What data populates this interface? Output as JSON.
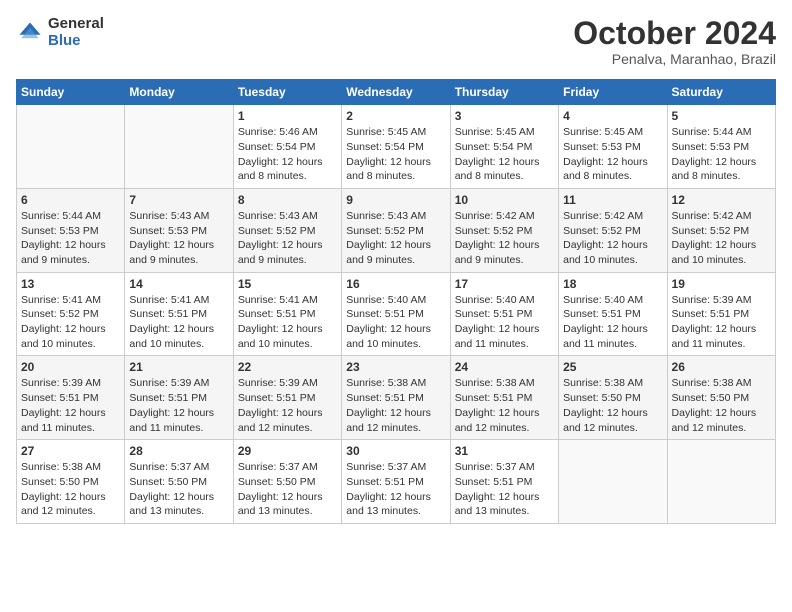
{
  "logo": {
    "general": "General",
    "blue": "Blue"
  },
  "title": "October 2024",
  "location": "Penalva, Maranhao, Brazil",
  "days_of_week": [
    "Sunday",
    "Monday",
    "Tuesday",
    "Wednesday",
    "Thursday",
    "Friday",
    "Saturday"
  ],
  "weeks": [
    [
      {
        "day": "",
        "info": ""
      },
      {
        "day": "",
        "info": ""
      },
      {
        "day": "1",
        "info": "Sunrise: 5:46 AM\nSunset: 5:54 PM\nDaylight: 12 hours and 8 minutes."
      },
      {
        "day": "2",
        "info": "Sunrise: 5:45 AM\nSunset: 5:54 PM\nDaylight: 12 hours and 8 minutes."
      },
      {
        "day": "3",
        "info": "Sunrise: 5:45 AM\nSunset: 5:54 PM\nDaylight: 12 hours and 8 minutes."
      },
      {
        "day": "4",
        "info": "Sunrise: 5:45 AM\nSunset: 5:53 PM\nDaylight: 12 hours and 8 minutes."
      },
      {
        "day": "5",
        "info": "Sunrise: 5:44 AM\nSunset: 5:53 PM\nDaylight: 12 hours and 8 minutes."
      }
    ],
    [
      {
        "day": "6",
        "info": "Sunrise: 5:44 AM\nSunset: 5:53 PM\nDaylight: 12 hours and 9 minutes."
      },
      {
        "day": "7",
        "info": "Sunrise: 5:43 AM\nSunset: 5:53 PM\nDaylight: 12 hours and 9 minutes."
      },
      {
        "day": "8",
        "info": "Sunrise: 5:43 AM\nSunset: 5:52 PM\nDaylight: 12 hours and 9 minutes."
      },
      {
        "day": "9",
        "info": "Sunrise: 5:43 AM\nSunset: 5:52 PM\nDaylight: 12 hours and 9 minutes."
      },
      {
        "day": "10",
        "info": "Sunrise: 5:42 AM\nSunset: 5:52 PM\nDaylight: 12 hours and 9 minutes."
      },
      {
        "day": "11",
        "info": "Sunrise: 5:42 AM\nSunset: 5:52 PM\nDaylight: 12 hours and 10 minutes."
      },
      {
        "day": "12",
        "info": "Sunrise: 5:42 AM\nSunset: 5:52 PM\nDaylight: 12 hours and 10 minutes."
      }
    ],
    [
      {
        "day": "13",
        "info": "Sunrise: 5:41 AM\nSunset: 5:52 PM\nDaylight: 12 hours and 10 minutes."
      },
      {
        "day": "14",
        "info": "Sunrise: 5:41 AM\nSunset: 5:51 PM\nDaylight: 12 hours and 10 minutes."
      },
      {
        "day": "15",
        "info": "Sunrise: 5:41 AM\nSunset: 5:51 PM\nDaylight: 12 hours and 10 minutes."
      },
      {
        "day": "16",
        "info": "Sunrise: 5:40 AM\nSunset: 5:51 PM\nDaylight: 12 hours and 10 minutes."
      },
      {
        "day": "17",
        "info": "Sunrise: 5:40 AM\nSunset: 5:51 PM\nDaylight: 12 hours and 11 minutes."
      },
      {
        "day": "18",
        "info": "Sunrise: 5:40 AM\nSunset: 5:51 PM\nDaylight: 12 hours and 11 minutes."
      },
      {
        "day": "19",
        "info": "Sunrise: 5:39 AM\nSunset: 5:51 PM\nDaylight: 12 hours and 11 minutes."
      }
    ],
    [
      {
        "day": "20",
        "info": "Sunrise: 5:39 AM\nSunset: 5:51 PM\nDaylight: 12 hours and 11 minutes."
      },
      {
        "day": "21",
        "info": "Sunrise: 5:39 AM\nSunset: 5:51 PM\nDaylight: 12 hours and 11 minutes."
      },
      {
        "day": "22",
        "info": "Sunrise: 5:39 AM\nSunset: 5:51 PM\nDaylight: 12 hours and 12 minutes."
      },
      {
        "day": "23",
        "info": "Sunrise: 5:38 AM\nSunset: 5:51 PM\nDaylight: 12 hours and 12 minutes."
      },
      {
        "day": "24",
        "info": "Sunrise: 5:38 AM\nSunset: 5:51 PM\nDaylight: 12 hours and 12 minutes."
      },
      {
        "day": "25",
        "info": "Sunrise: 5:38 AM\nSunset: 5:50 PM\nDaylight: 12 hours and 12 minutes."
      },
      {
        "day": "26",
        "info": "Sunrise: 5:38 AM\nSunset: 5:50 PM\nDaylight: 12 hours and 12 minutes."
      }
    ],
    [
      {
        "day": "27",
        "info": "Sunrise: 5:38 AM\nSunset: 5:50 PM\nDaylight: 12 hours and 12 minutes."
      },
      {
        "day": "28",
        "info": "Sunrise: 5:37 AM\nSunset: 5:50 PM\nDaylight: 12 hours and 13 minutes."
      },
      {
        "day": "29",
        "info": "Sunrise: 5:37 AM\nSunset: 5:50 PM\nDaylight: 12 hours and 13 minutes."
      },
      {
        "day": "30",
        "info": "Sunrise: 5:37 AM\nSunset: 5:51 PM\nDaylight: 12 hours and 13 minutes."
      },
      {
        "day": "31",
        "info": "Sunrise: 5:37 AM\nSunset: 5:51 PM\nDaylight: 12 hours and 13 minutes."
      },
      {
        "day": "",
        "info": ""
      },
      {
        "day": "",
        "info": ""
      }
    ]
  ]
}
